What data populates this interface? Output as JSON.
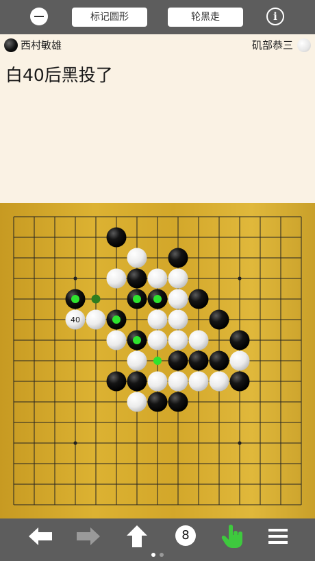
{
  "toolbar": {
    "mark_label": "标记圆形",
    "turn_label": "轮黑走",
    "info_glyph": "i"
  },
  "players": {
    "black": "西村敏雄",
    "white": "矶部恭三"
  },
  "comment": "白40后黑投了",
  "board": {
    "size": 15,
    "hoshi": [
      [
        3,
        3
      ],
      [
        11,
        3
      ],
      [
        3,
        11
      ],
      [
        11,
        11
      ],
      [
        7,
        7
      ]
    ],
    "black_stones": [
      [
        5,
        1
      ],
      [
        8,
        2
      ],
      [
        6,
        3
      ],
      [
        3,
        4
      ],
      [
        6,
        4
      ],
      [
        7,
        4
      ],
      [
        9,
        4
      ],
      [
        10,
        5
      ],
      [
        5,
        5
      ],
      [
        11,
        6
      ],
      [
        6,
        6
      ],
      [
        8,
        7
      ],
      [
        9,
        7
      ],
      [
        10,
        7
      ],
      [
        5,
        8
      ],
      [
        6,
        8
      ],
      [
        11,
        8
      ],
      [
        7,
        9
      ],
      [
        8,
        9
      ]
    ],
    "white_stones": [
      [
        6,
        2
      ],
      [
        5,
        3
      ],
      [
        7,
        3
      ],
      [
        8,
        3
      ],
      [
        8,
        4
      ],
      [
        4,
        5
      ],
      [
        7,
        5
      ],
      [
        8,
        5
      ],
      [
        5,
        6
      ],
      [
        7,
        6
      ],
      [
        8,
        6
      ],
      [
        9,
        6
      ],
      [
        6,
        7
      ],
      [
        11,
        7
      ],
      [
        7,
        8
      ],
      [
        8,
        8
      ],
      [
        9,
        8
      ],
      [
        10,
        8
      ],
      [
        6,
        9
      ]
    ],
    "numbered_stone": {
      "col": 3,
      "row": 5,
      "label": "40"
    },
    "green_marks": [
      [
        3,
        4
      ],
      [
        6,
        4
      ],
      [
        7,
        4
      ],
      [
        5,
        5
      ],
      [
        6,
        6
      ],
      [
        7,
        7
      ]
    ],
    "small_green_mark": [
      4,
      4
    ]
  },
  "bottom_toolbar": {
    "items": [
      "back-arrow-icon",
      "forward-arrow-icon",
      "up-arrow-icon",
      "move-count-badge",
      "hand-pointer-icon",
      "menu-icon"
    ],
    "move_count": "8",
    "accent": "#3ec93e"
  },
  "page_dots": {
    "count": 2,
    "active": 0
  }
}
